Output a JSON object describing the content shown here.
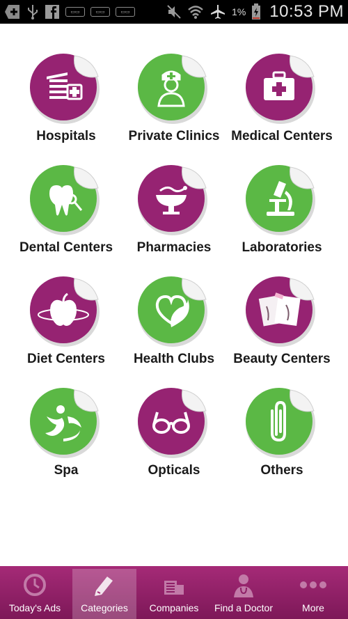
{
  "status_bar": {
    "battery_percent": "1%",
    "time": "10:53 PM",
    "left_icons": [
      "add-icon",
      "usb-icon",
      "facebook-icon",
      "mini-notification-icon",
      "mini-notification-icon",
      "mini-notification-icon"
    ],
    "right_icons": [
      "mute-icon",
      "wifi-icon",
      "airplane-icon",
      "battery-charging-icon"
    ]
  },
  "colors": {
    "purple": "#962372",
    "green": "#5bb845",
    "nav_top": "#a52a77",
    "nav_bottom": "#7d1858"
  },
  "categories": [
    {
      "label": "Hospitals",
      "color": "purple",
      "icon": "hospital-building-icon"
    },
    {
      "label": "Private Clinics",
      "color": "green",
      "icon": "nurse-icon"
    },
    {
      "label": "Medical Centers",
      "color": "purple",
      "icon": "first-aid-kit-icon"
    },
    {
      "label": "Dental Centers",
      "color": "green",
      "icon": "tooth-icon"
    },
    {
      "label": "Pharmacies",
      "color": "purple",
      "icon": "bowl-of-hygieia-icon"
    },
    {
      "label": "Laboratories",
      "color": "green",
      "icon": "microscope-icon"
    },
    {
      "label": "Diet Centers",
      "color": "purple",
      "icon": "apple-measuring-tape-icon"
    },
    {
      "label": "Health Clubs",
      "color": "green",
      "icon": "heart-leaf-icon"
    },
    {
      "label": "Beauty Centers",
      "color": "purple",
      "icon": "beauty-photos-icon"
    },
    {
      "label": "Spa",
      "color": "green",
      "icon": "spa-figure-icon"
    },
    {
      "label": "Opticals",
      "color": "purple",
      "icon": "eyeglasses-icon"
    },
    {
      "label": "Others",
      "color": "green",
      "icon": "paperclip-icon"
    }
  ],
  "bottom_nav": [
    {
      "label": "Today's Ads",
      "icon": "clock-icon",
      "active": false
    },
    {
      "label": "Categories",
      "icon": "pencil-tag-icon",
      "active": true
    },
    {
      "label": "Companies",
      "icon": "buildings-icon",
      "active": false
    },
    {
      "label": "Find a Doctor",
      "icon": "doctor-icon",
      "active": false
    },
    {
      "label": "More",
      "icon": "more-dots-icon",
      "active": false
    }
  ]
}
